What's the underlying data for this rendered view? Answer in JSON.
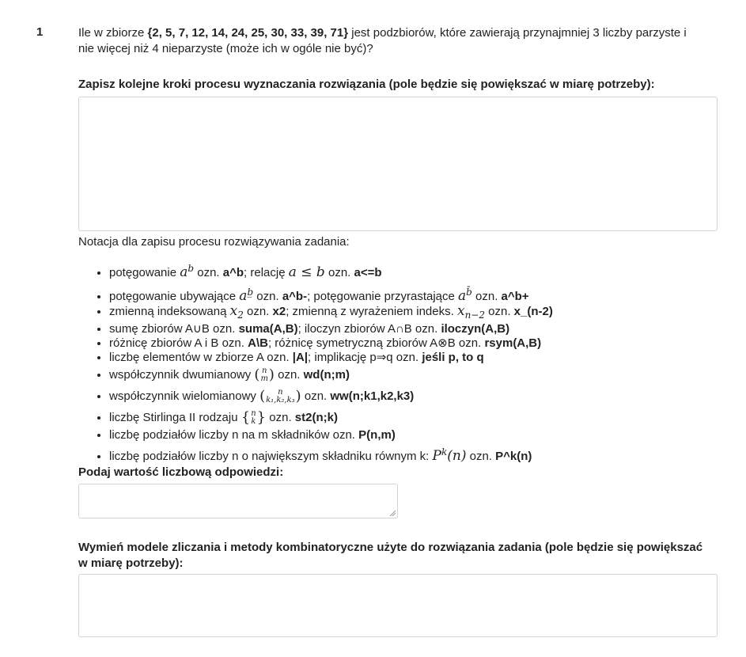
{
  "question": {
    "number": "1",
    "text_pre": "Ile w zbiorze ",
    "set": "{2, 5, 7, 12, 14, 24, 25, 30, 33, 39, 71}",
    "text_post": " jest podzbiorów, które zawierają przynajmniej 3 liczby parzyste i nie więcej niż 4 nieparzyste (może ich w ogóle nie być)?"
  },
  "steps": {
    "label": "Zapisz kolejne kroki procesu wyznaczania rozwiązania (pole będzie się powiększać w miarę potrzeby):",
    "value": ""
  },
  "notation": {
    "title": "Notacja dla zapisu procesu rozwiązywania zadania:",
    "items": [
      {
        "a": "potęgowanie ",
        "m1": "a",
        "sup1": "b",
        "b": " ozn. ",
        "c1": "a^b",
        "d": ";   relację ",
        "m2": "a ≤ b",
        "e": " ozn. ",
        "c2": "a<=b"
      },
      {
        "a": "potęgowanie ubywające ",
        "m1": "a",
        "sup1": "b̲",
        "b": " ozn. ",
        "c1": "a^b-",
        "d": ";   potęgowanie przyrastające ",
        "m2": "a",
        "sup2": "b̄",
        "e": " ozn. ",
        "c2": "a^b+"
      },
      {
        "a": "zmienną indeksowaną ",
        "m1": "x",
        "sub1": "2",
        "b": " ozn. ",
        "c1": "x2",
        "d": ";  zmienną z wyrażeniem indeks. ",
        "m2": "x",
        "sub2": "n−2",
        "e": " ozn. ",
        "c2": "x_(n-2)"
      },
      {
        "a": "sumę zbiorów A∪B ozn. ",
        "c1": "suma(A,B)",
        "d": ";   iloczyn zbiorów A∩B ozn. ",
        "c2": "iloczyn(A,B)"
      },
      {
        "a": "różnicę zbiorów A i B ozn. ",
        "c1": "A\\B",
        "d": ";   różnicę symetryczną zbiorów A⊗B ozn. ",
        "c2": "rsym(A,B)"
      },
      {
        "a": "liczbę elementów w zbiorze A ozn. ",
        "c1": "|A|",
        "d": ";   implikację p⇒q ozn. ",
        "c2": "jeśli p, to q"
      },
      {
        "a": "współczynnik dwumianowy ",
        "top": "n",
        "bot": "m",
        "e": " ozn. ",
        "c1": "wd(n;m)"
      },
      {
        "a": "współczynnik wielomianowy ",
        "top": "n",
        "bot": "k₁,k₂,k₃",
        "e": " ozn. ",
        "c1": "ww(n;k1,k2,k3)"
      },
      {
        "a": "liczbę Stirlinga II rodzaju ",
        "top": "n",
        "bot": "k",
        "e": " ozn. ",
        "c1": "st2(n;k)"
      },
      {
        "a": "liczbę podziałów liczby n na m składników ozn. ",
        "c1": "P(n,m)"
      },
      {
        "a": "liczbę podziałów liczby n o największym składniku równym k: ",
        "m1": "P",
        "sup1": "k",
        "m1b": "(n)",
        "e": " ozn. ",
        "c1": "P^k(n)"
      }
    ]
  },
  "answer": {
    "label": "Podaj wartość liczbową odpowiedzi:",
    "value": ""
  },
  "models": {
    "label": "Wymień modele zliczania i metody kombinatoryczne użyte do rozwiązania zadania (pole będzie się powiększać w miarę potrzeby):",
    "value": ""
  }
}
